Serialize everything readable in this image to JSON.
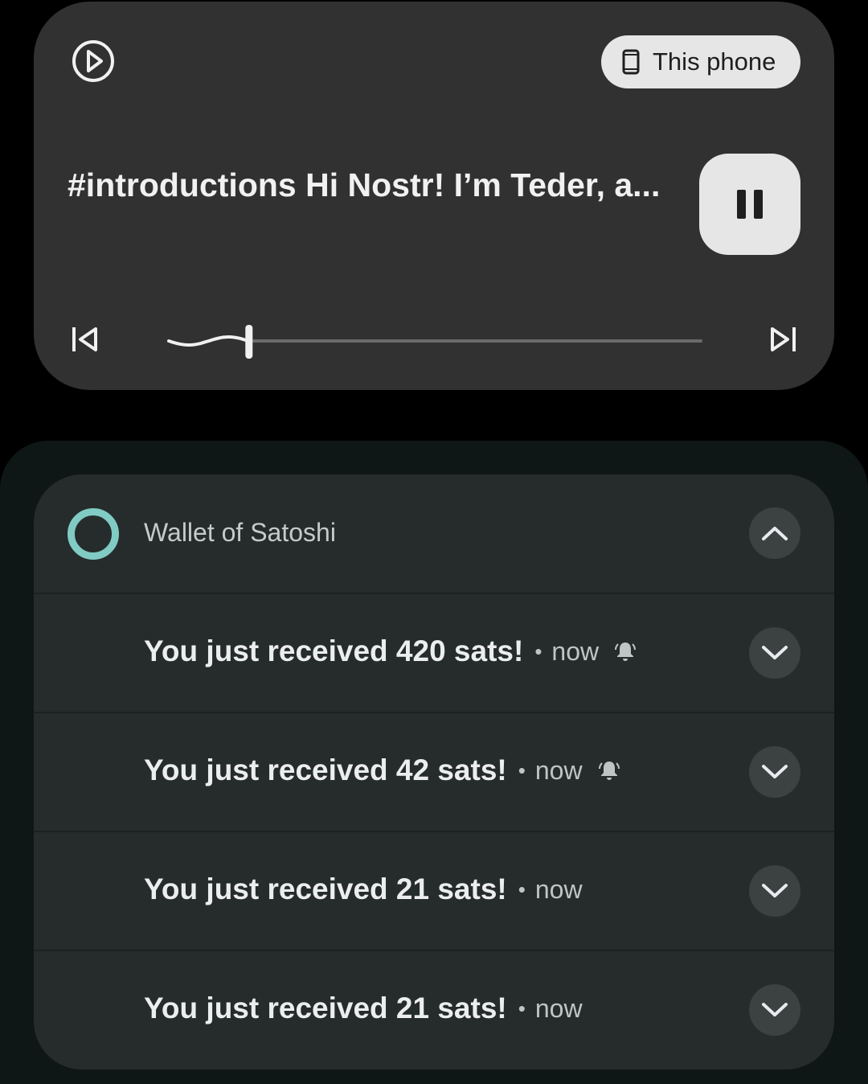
{
  "media": {
    "output_label": "This phone",
    "title": "#introductions Hi Nostr! I’m Teder, a...",
    "progress_percent": 15
  },
  "notifications": {
    "app_name": "Wallet of Satoshi",
    "accent_color": "#80cbc4",
    "items": [
      {
        "title": "You just received 420 sats!",
        "dot": "•",
        "time": "now",
        "icon": "bell-icon"
      },
      {
        "title": "You just received 42 sats!",
        "dot": "•",
        "time": "now",
        "icon": "bell-icon"
      },
      {
        "title": "You just received 21 sats!",
        "dot": "•",
        "time": "now"
      },
      {
        "title": "You just received 21 sats!",
        "dot": "•",
        "time": "now"
      }
    ]
  }
}
